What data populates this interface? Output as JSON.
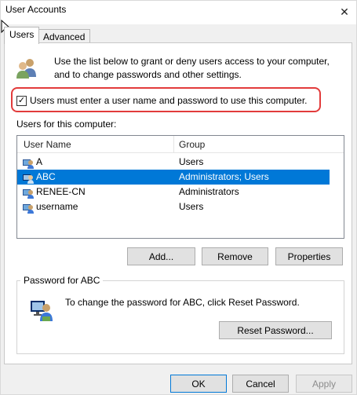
{
  "window": {
    "title": "User Accounts",
    "close_glyph": "✕"
  },
  "tabs": [
    {
      "label": "Users",
      "active": true
    },
    {
      "label": "Advanced",
      "active": false
    }
  ],
  "intro": {
    "icon": "users-group-icon",
    "text": "Use the list below to grant or deny users access to your computer, and to change passwords and other settings."
  },
  "must_login": {
    "label": "Users must enter a user name and password to use this computer.",
    "checked": true,
    "check_glyph": "✓"
  },
  "users_label": "Users for this computer:",
  "users_table": {
    "columns": [
      "User Name",
      "Group"
    ],
    "rows": [
      {
        "name": "A",
        "group": "Users",
        "selected": false
      },
      {
        "name": "ABC",
        "group": "Administrators; Users",
        "selected": true
      },
      {
        "name": "RENEE-CN",
        "group": "Administrators",
        "selected": false
      },
      {
        "name": "username",
        "group": "Users",
        "selected": false
      }
    ]
  },
  "list_buttons": {
    "add": "Add...",
    "remove": "Remove",
    "properties": "Properties"
  },
  "password": {
    "legend": "Password for ABC",
    "text": "To change the password for ABC, click Reset Password.",
    "reset_button": "Reset Password..."
  },
  "footer": {
    "ok": "OK",
    "cancel": "Cancel",
    "apply": "Apply"
  },
  "colors": {
    "selection": "#0078d7",
    "highlight_outline": "#e23b3b",
    "button_face": "#e1e1e1",
    "dialog_bg": "#f0f0f0"
  }
}
